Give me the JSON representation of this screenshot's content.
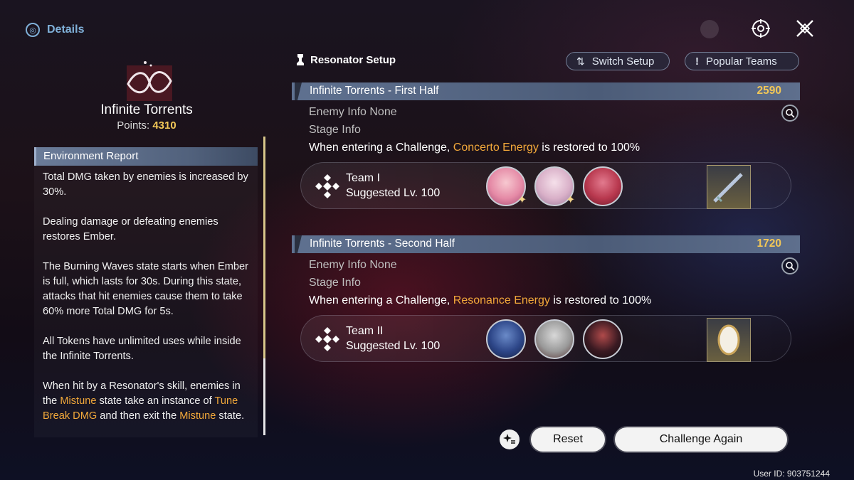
{
  "header": {
    "back_label": "Details"
  },
  "left": {
    "title": "Infinite Torrents",
    "points_label": "Points:",
    "points_value": "4310",
    "env_header": "Environment Report",
    "env": {
      "p1": "Total DMG taken by enemies is increased by 30%.",
      "p2": "Dealing damage or defeating enemies restores Ember.",
      "p3": "The Burning Waves state starts when Ember is full, which lasts for 30s. During this state, attacks that hit enemies cause them to take 60% more Total DMG for 5s.",
      "p4": "All Tokens have unlimited uses while inside the Infinite Torrents.",
      "p5_a": "When hit by a Resonator's skill, enemies in the ",
      "p5_hl1": "Mistune",
      "p5_b": " state take an instance of ",
      "p5_hl2": "Tune Break DMG",
      "p5_c": " and then exit the ",
      "p5_hl3": "Mistune",
      "p5_d": " state."
    }
  },
  "setup": {
    "title": "Resonator Setup",
    "switch_label": "Switch Setup",
    "popular_label": "Popular Teams"
  },
  "stages": [
    {
      "name": "Infinite Torrents - First Half",
      "score": "2590",
      "enemy_info": "Enemy Info  None",
      "stage_info": "Stage Info",
      "desc_a": "When entering a Challenge, ",
      "desc_hl": "Concerto Energy",
      "desc_b": " is restored to 100%",
      "team_name": "Team I",
      "team_level": "Suggested Lv. 100"
    },
    {
      "name": "Infinite Torrents - Second Half",
      "score": "1720",
      "enemy_info": "Enemy Info  None",
      "stage_info": "Stage Info",
      "desc_a": "When entering a Challenge, ",
      "desc_hl": "Resonance Energy",
      "desc_b": " is restored to 100%",
      "team_name": "Team II",
      "team_level": "Suggested Lv. 100"
    }
  ],
  "footer": {
    "reset_label": "Reset",
    "challenge_label": "Challenge Again",
    "user_id": "User ID: 903751244"
  },
  "colors": {
    "accent_gold": "#f2c757",
    "highlight_orange": "#f2a83a",
    "header_blue": "#7fb0d8"
  }
}
